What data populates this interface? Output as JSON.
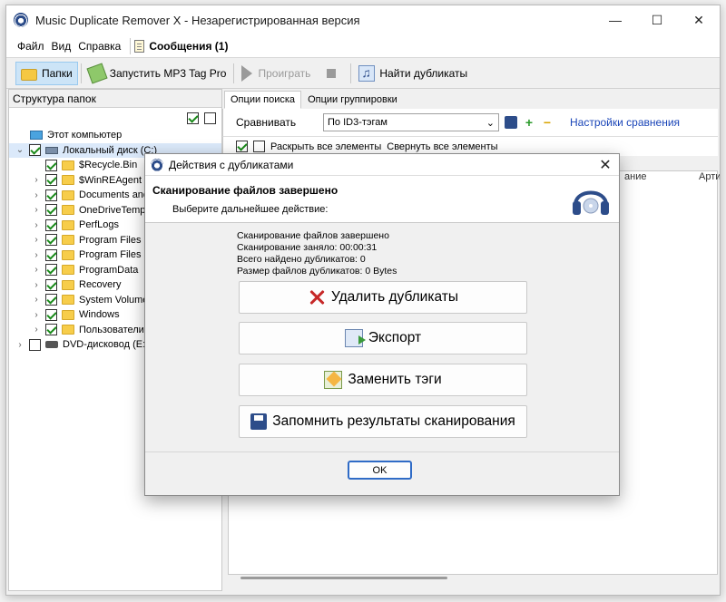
{
  "window": {
    "title": "Music Duplicate Remover X - Незарегистрированная версия"
  },
  "menu": {
    "file": "Файл",
    "view": "Вид",
    "help": "Справка",
    "messages": "Сообщения (1)"
  },
  "toolbar": {
    "folders": "Папки",
    "run_tag_pro": "Запустить MP3 Tag Pro",
    "play": "Проиграть",
    "find_duplicates": "Найти дубликаты"
  },
  "left_panel": {
    "header": "Структура папок",
    "tree": [
      {
        "label": "Этот компьютер",
        "icon": "computer-icon",
        "level": 0,
        "chevron": "",
        "checkbox": "none"
      },
      {
        "label": "Локальный диск (C:)",
        "icon": "drive-icon",
        "level": 0,
        "chevron": "⌄",
        "checkbox": "on"
      },
      {
        "label": "$Recycle.Bin",
        "icon": "folder-icon",
        "level": 1,
        "chevron": "",
        "checkbox": "on"
      },
      {
        "label": "$WinREAgent",
        "icon": "folder-icon",
        "level": 1,
        "chevron": "›",
        "checkbox": "on"
      },
      {
        "label": "Documents and",
        "icon": "folder-icon",
        "level": 1,
        "chevron": "›",
        "checkbox": "on"
      },
      {
        "label": "OneDriveTemp",
        "icon": "folder-icon",
        "level": 1,
        "chevron": "›",
        "checkbox": "on"
      },
      {
        "label": "PerfLogs",
        "icon": "folder-icon",
        "level": 1,
        "chevron": "›",
        "checkbox": "on"
      },
      {
        "label": "Program Files",
        "icon": "folder-icon",
        "level": 1,
        "chevron": "›",
        "checkbox": "on"
      },
      {
        "label": "Program Files (x",
        "icon": "folder-icon",
        "level": 1,
        "chevron": "›",
        "checkbox": "on"
      },
      {
        "label": "ProgramData",
        "icon": "folder-icon",
        "level": 1,
        "chevron": "›",
        "checkbox": "on"
      },
      {
        "label": "Recovery",
        "icon": "folder-icon",
        "level": 1,
        "chevron": "›",
        "checkbox": "on"
      },
      {
        "label": "System Volume",
        "icon": "folder-icon",
        "level": 1,
        "chevron": "›",
        "checkbox": "on"
      },
      {
        "label": "Windows",
        "icon": "folder-icon",
        "level": 1,
        "chevron": "›",
        "checkbox": "on"
      },
      {
        "label": "Пользователи",
        "icon": "folder-icon",
        "level": 1,
        "chevron": "›",
        "checkbox": "on"
      },
      {
        "label": "DVD-дисковод (E:)",
        "icon": "dvd-icon",
        "level": 0,
        "chevron": "›",
        "checkbox": "off"
      }
    ]
  },
  "right_panel": {
    "tabs": [
      "Опции поиска",
      "Опции группировки"
    ],
    "compare_label": "Сравнивать",
    "compare_value": "По ID3-тэгам",
    "compare_settings": "Настройки сравнения",
    "expand_all": "Раскрыть все элементы",
    "collapse_all": "Свернуть все элементы",
    "columns": [
      "ание",
      "Артис"
    ]
  },
  "dialog": {
    "title": "Действия с дубликатами",
    "heading": "Сканирование файлов завершено",
    "subheading": "Выберите дальнейшее действие:",
    "stats": [
      "Сканирование файлов завершено",
      "Сканирование заняло: 00:00:31",
      "Всего найдено дубликатов: 0",
      "Размер файлов дубликатов: 0 Bytes"
    ],
    "actions": {
      "delete": "Удалить дубликаты",
      "export": "Экспорт",
      "replace_tags": "Заменить тэги",
      "save_results": "Запомнить результаты сканирования"
    },
    "ok": "OK"
  },
  "colors": {
    "accent": "#2f6bc6",
    "selection": "#cce4f7",
    "link": "#1a45b8"
  }
}
